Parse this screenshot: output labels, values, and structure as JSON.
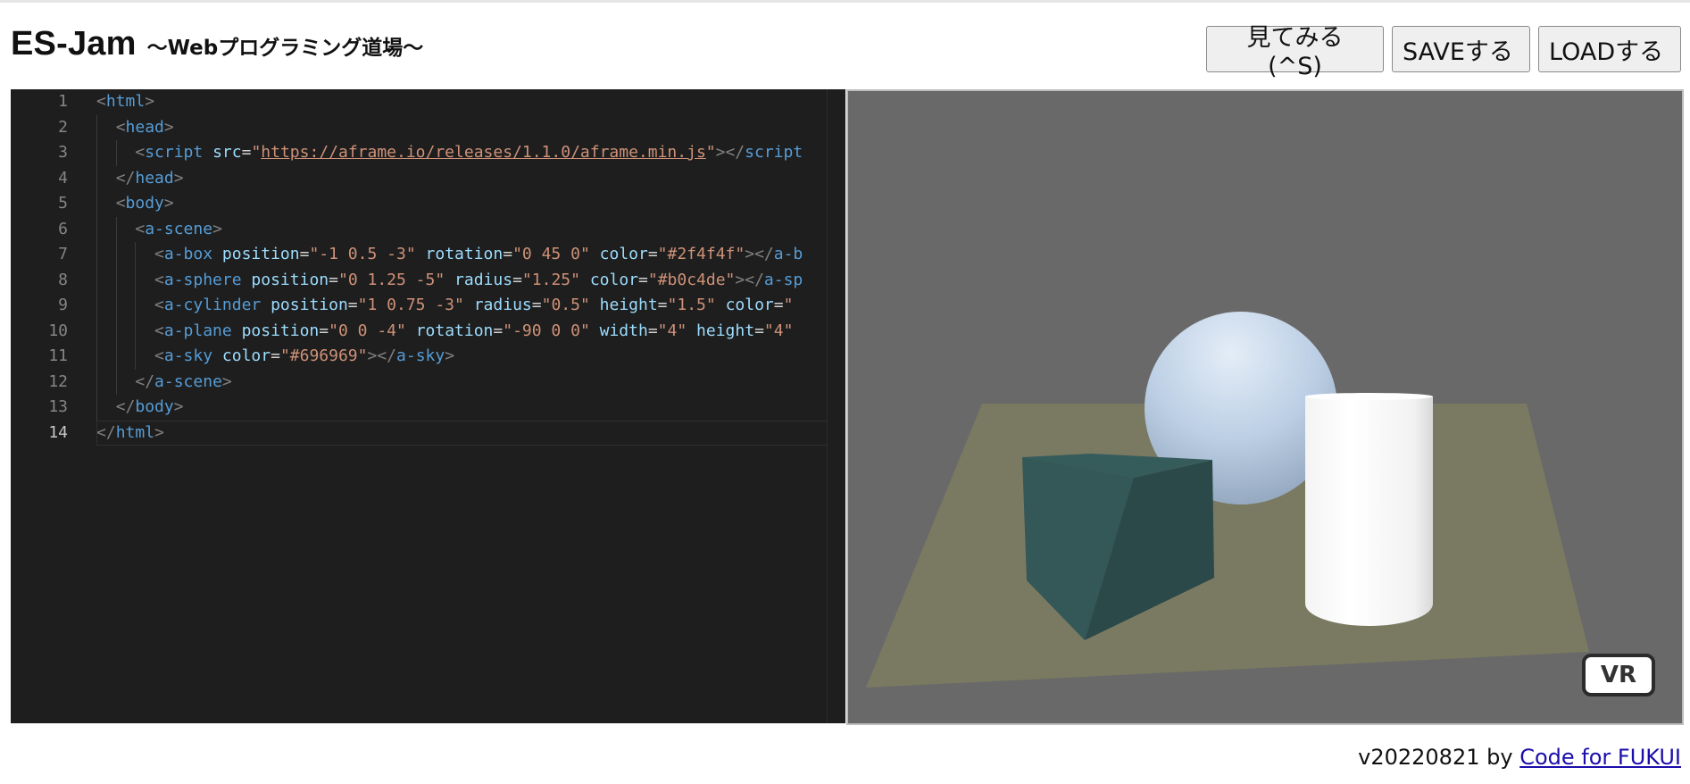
{
  "header": {
    "title": "ES-Jam",
    "subtitle": "〜Webプログラミング道場〜"
  },
  "toolbar": {
    "preview_label": "見てみる (^S)",
    "save_label": "SAVEする",
    "load_label": "LOADする"
  },
  "editor": {
    "current_line": 14,
    "lines": [
      "<html>",
      "  <head>",
      "    <script src=\"https://aframe.io/releases/1.1.0/aframe.min.js\"></script",
      "  </head>",
      "  <body>",
      "    <a-scene>",
      "      <a-box position=\"-1 0.5 -3\" rotation=\"0 45 0\" color=\"#2f4f4f\"></a-b",
      "      <a-sphere position=\"0 1.25 -5\" radius=\"1.25\" color=\"#b0c4de\"></a-sp",
      "      <a-cylinder position=\"1 0.75 -3\" radius=\"0.5\" height=\"1.5\" color=\"#",
      "      <a-plane position=\"0 0 -4\" rotation=\"-90 0 0\" width=\"4\" height=\"4\" ",
      "      <a-sky color=\"#696969\"></a-sky>",
      "    </a-scene>",
      "  </body>",
      "</html>"
    ]
  },
  "preview": {
    "sky_color": "#696969",
    "box_color": "#2f4f4f",
    "sphere_color": "#b0c4de",
    "cylinder_color": "#ffffff",
    "plane_color": "#7a7a62",
    "vr_label": "VR"
  },
  "footer": {
    "version_text": "v20220821 by ",
    "link_text": "Code for FUKUI"
  }
}
